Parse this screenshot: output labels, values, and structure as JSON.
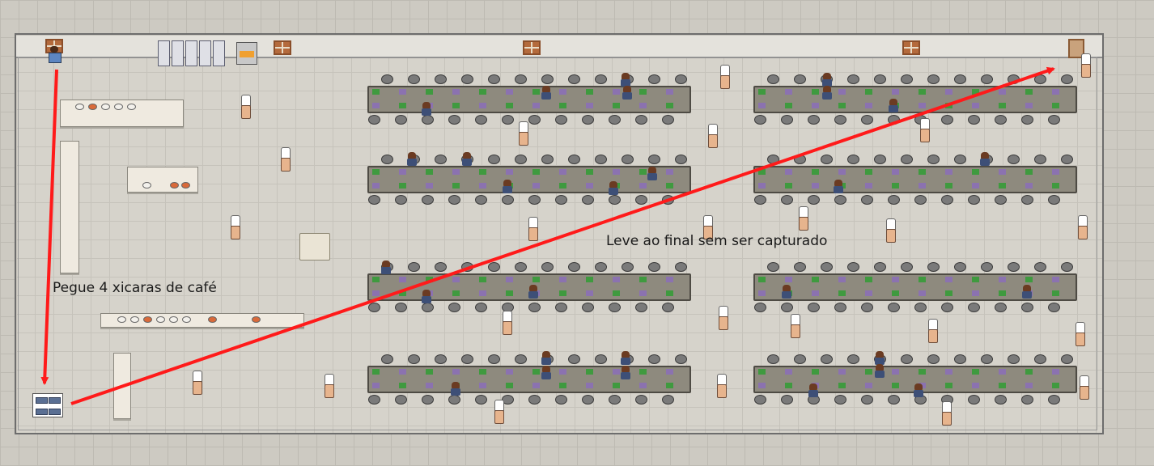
{
  "annotations": {
    "pickup_instruction": "Pegue 4 xicaras de café",
    "goal_instruction": "Leve ao final sem ser capturado"
  },
  "colors": {
    "arrow": "#ff1a1a",
    "table": "#8e8a7e",
    "floor": "#d6d3cb"
  },
  "icons": {
    "player": "player-character-icon",
    "enemy": "chef-guard-icon",
    "customer": "seated-customer-icon",
    "item": "coffee-cup-box-icon"
  },
  "level": {
    "coffee_cups_required": 4
  }
}
